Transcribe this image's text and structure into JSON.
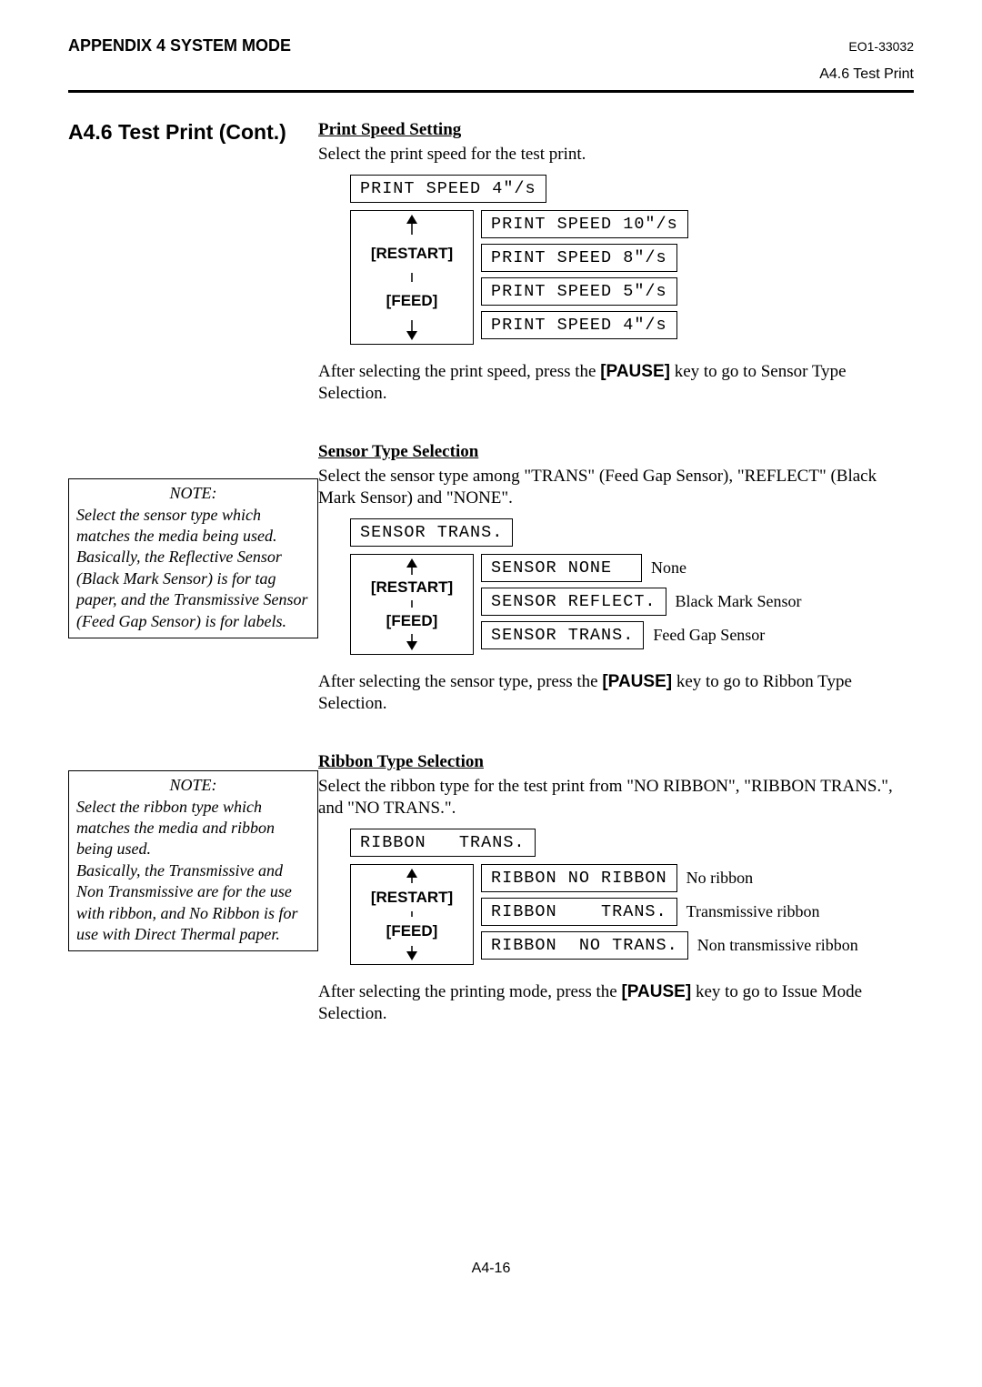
{
  "header": {
    "left": "APPENDIX 4 SYSTEM MODE",
    "right": "EO1-33032",
    "sub_right": "A4.6 Test Print"
  },
  "section_title": "A4.6  Test Print (Cont.)",
  "speed": {
    "title": "Print Speed Setting",
    "desc": "Select the print speed for the test print.",
    "current": "PRINT SPEED 4\"/s",
    "restart": "[RESTART]",
    "feed": "[FEED]",
    "options": [
      "PRINT SPEED 10\"/s",
      "PRINT SPEED 8\"/s",
      "PRINT SPEED 5\"/s",
      "PRINT SPEED 4\"/s"
    ],
    "after_a": "After selecting the print speed, press the ",
    "after_key": "[PAUSE]",
    "after_b": " key to go to Sensor Type Selection."
  },
  "sensor": {
    "note_title": "NOTE:",
    "note_body": "Select the sensor type which matches the media being used. Basically, the Reflective Sensor (Black Mark Sensor) is for tag paper, and the Transmissive Sensor (Feed Gap Sensor) is for labels.",
    "title": "Sensor Type Selection",
    "desc": "Select the sensor type among \"TRANS\" (Feed Gap Sensor), \"REFLECT\" (Black Mark Sensor) and \"NONE\".",
    "current": "SENSOR TRANS.",
    "restart": "[RESTART]",
    "feed": "[FEED]",
    "options": [
      {
        "lcd": "SENSOR NONE",
        "label": "None"
      },
      {
        "lcd": "SENSOR REFLECT.",
        "label": "Black Mark Sensor"
      },
      {
        "lcd": "SENSOR TRANS.",
        "label": "Feed Gap Sensor"
      }
    ],
    "after_a": "After selecting the sensor type, press the ",
    "after_key": "[PAUSE]",
    "after_b": " key to go to Ribbon Type Selection."
  },
  "ribbon": {
    "note_title": "NOTE:",
    "note_body": "Select the ribbon type which matches the media and ribbon being used.\nBasically, the Transmissive and Non Transmissive are  for the use with ribbon, and No Ribbon is for use with Direct Thermal paper.",
    "title": "Ribbon Type Selection",
    "desc": "Select the ribbon type for the test print from \"NO RIBBON\", \"RIBBON TRANS.\", and \"NO TRANS.\".",
    "current": "RIBBON   TRANS.",
    "restart": "[RESTART]",
    "feed": "[FEED]",
    "options": [
      {
        "lcd": "RIBBON NO RIBBON",
        "label": "No ribbon"
      },
      {
        "lcd": "RIBBON    TRANS.",
        "label": "Transmissive ribbon"
      },
      {
        "lcd": "RIBBON  NO TRANS.",
        "label": "Non transmissive ribbon"
      }
    ],
    "after_a": "After selecting the printing mode, press the ",
    "after_key": "[PAUSE]",
    "after_b": " key to go to Issue Mode Selection."
  },
  "page_num": "A4-16"
}
